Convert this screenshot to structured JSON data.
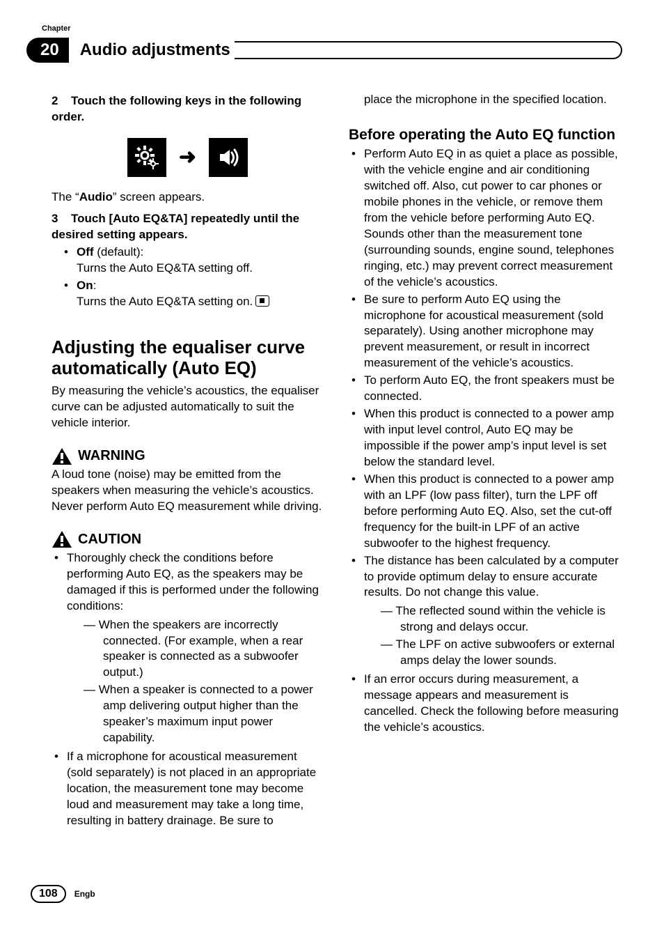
{
  "header": {
    "chapter_label": "Chapter",
    "chapter_number": "20",
    "title": "Audio adjustments"
  },
  "left": {
    "step2_num": "2",
    "step2_text": "Touch the following keys in the following order.",
    "icons": {
      "settings_icon": "settings-icon",
      "arrow": "➜",
      "audio_icon": "audio-icon"
    },
    "audio_prefix": "The “",
    "audio_bold": "Audio",
    "audio_suffix": "” screen appears.",
    "step3_num": "3",
    "step3_text": "Touch [Auto EQ&TA] repeatedly until the desired setting appears.",
    "off_label": "Off",
    "off_default": " (default):",
    "off_desc": "Turns the Auto EQ&TA setting off.",
    "on_label": "On",
    "on_colon": ":",
    "on_desc": "Turns the Auto EQ&TA setting on.",
    "section_h": "Adjusting the equaliser curve automatically (Auto EQ)",
    "section_p": "By measuring the vehicle’s acoustics, the equaliser curve can be adjusted automatically to suit the vehicle interior.",
    "warning_label": "WARNING",
    "warning_text": "A loud tone (noise) may be emitted from the speakers when measuring the vehicle’s acoustics. Never perform Auto EQ measurement while driving.",
    "caution_label": "CAUTION",
    "caution_b1": "Thoroughly check the conditions before performing Auto EQ, as the speakers may be damaged if this is performed under the following conditions:",
    "caution_d1": "— When the speakers are incorrectly connected. (For example, when a rear speaker is connected as a subwoofer output.)",
    "caution_d2": "— When a speaker is connected to a power amp delivering output higher than the speaker’s maximum input power capability.",
    "caution_b2": "If a microphone for acoustical measurement (sold separately) is not placed in an appropriate location, the measurement tone may become loud and measurement may take a long time, resulting in battery drainage. Be sure to"
  },
  "right": {
    "cont": "place the microphone in the specified location.",
    "sub_h": "Before operating the Auto EQ function",
    "bullets": {
      "b1": "Perform Auto EQ in as quiet a place as possible, with the vehicle engine and air conditioning switched off. Also, cut power to car phones or mobile phones in the vehicle, or remove them from the vehicle before performing Auto EQ. Sounds other than the measurement tone (surrounding sounds, engine sound, telephones ringing, etc.) may prevent correct measurement of the vehicle’s acoustics.",
      "b2": "Be sure to perform Auto EQ using the microphone for acoustical measurement (sold separately). Using another microphone may prevent measurement, or result in incorrect measurement of the vehicle’s acoustics.",
      "b3": "To perform Auto EQ, the front speakers must be connected.",
      "b4": "When this product is connected to a power amp with input level control, Auto EQ may be impossible if the power amp’s input level is set below the standard level.",
      "b5": "When this product is connected to a power amp with an LPF (low pass filter), turn the LPF off before performing Auto EQ. Also, set the cut-off frequency for the built-in LPF of an active subwoofer to the highest frequency.",
      "b6": "The distance has been calculated by a computer to provide optimum delay to ensure accurate results. Do not change this value.",
      "b6_d1": "— The reflected sound within the vehicle is strong and delays occur.",
      "b6_d2": "— The LPF on active subwoofers or external amps delay the lower sounds.",
      "b7": "If an error occurs during measurement, a message appears and measurement is cancelled. Check the following before measuring the vehicle’s acoustics."
    }
  },
  "footer": {
    "page": "108",
    "lang": "Engb"
  }
}
